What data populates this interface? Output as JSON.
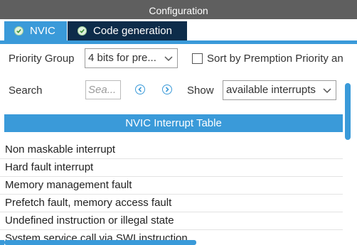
{
  "window": {
    "title": "Configuration"
  },
  "tabs": [
    {
      "label": "NVIC",
      "icon": "check-circle-icon"
    },
    {
      "label": "Code generation",
      "icon": "check-circle-icon"
    }
  ],
  "controls": {
    "priority_group_label": "Priority Group",
    "priority_group_value": "4 bits for pre...",
    "sort_checkbox_label": "Sort by Premption Priority an",
    "sort_checked": false,
    "search_label": "Search",
    "search_placeholder": "Sea...",
    "show_label": "Show",
    "show_value": "available interrupts"
  },
  "table": {
    "title": "NVIC Interrupt Table",
    "rows": [
      "Non maskable interrupt",
      "Hard fault interrupt",
      "Memory management fault",
      "Prefetch fault, memory access fault",
      "Undefined instruction or illegal state",
      "System service call via SWI instruction"
    ]
  },
  "colors": {
    "accent": "#3a9ad9",
    "tab_dark": "#0d2c4a",
    "titlebar": "#5f5f5f"
  }
}
